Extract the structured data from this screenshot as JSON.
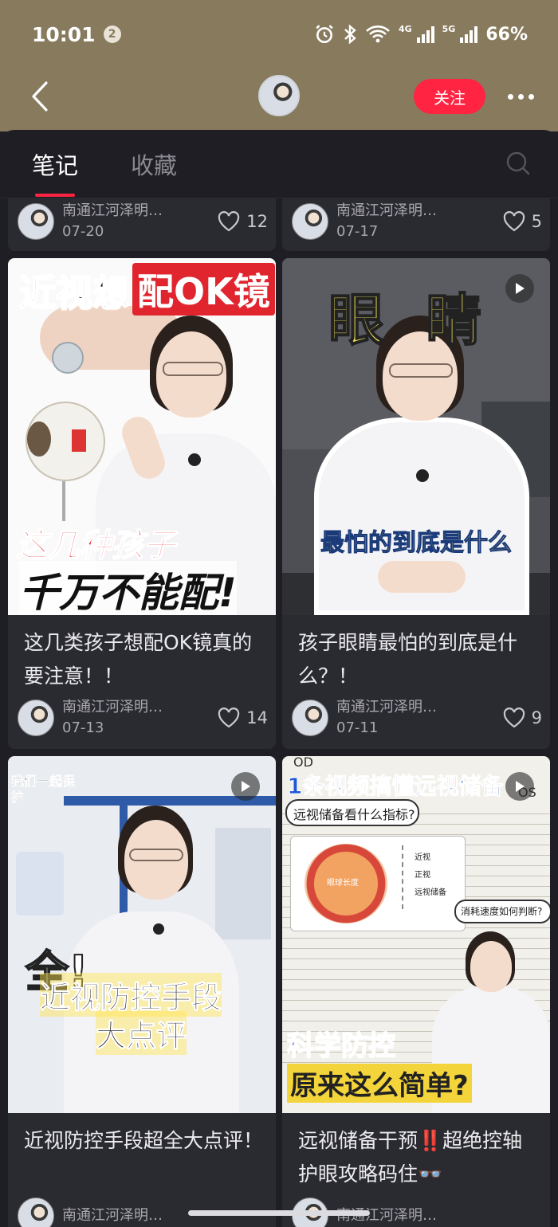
{
  "status": {
    "time": "10:01",
    "notif_count": "2",
    "battery": "66%",
    "net_4g": "4G",
    "net_5g": "5G"
  },
  "nav": {
    "follow_label": "关注"
  },
  "tabs": [
    {
      "label": "笔记",
      "active": true
    },
    {
      "label": "收藏",
      "active": false
    }
  ],
  "notes": [
    {
      "author": "南通江河泽明…",
      "date": "07-20",
      "likes": "12"
    },
    {
      "author": "南通江河泽明…",
      "date": "07-17",
      "likes": "5"
    },
    {
      "title": "这几类孩子想配OK镜真的要注意！！",
      "author": "南通江河泽明…",
      "date": "07-13",
      "likes": "14",
      "thumb_text_top_a": "近视想",
      "thumb_text_top_b": "配OK镜",
      "thumb_text_mid": "这几种孩子",
      "thumb_text_bottom": "千万不能配!"
    },
    {
      "title": "孩子眼睛最怕的到底是什么？！",
      "author": "南通江河泽明…",
      "date": "07-11",
      "likes": "9",
      "thumb_text_top": "眼 睛",
      "thumb_text_caption": "最怕的到底是什么"
    },
    {
      "title": "近视防控手段超全大点评！",
      "author": "南通江河泽明…",
      "thumb_text_corner": "我们一起保护",
      "thumb_text_a": "全!",
      "thumb_text_b": "近视防控手段",
      "thumb_text_c": "大点评"
    },
    {
      "title": "远视储备干预‼️超绝控轴护眼攻略码住👓",
      "author": "南通江河泽明…",
      "thumb_text_header": "1条视频搞懂远视储备",
      "thumb_text_od": "OD",
      "thumb_text_os": "OS",
      "thumb_text_q1": "远视储备看什么指标?",
      "thumb_text_q2": "消耗速度如何判断?",
      "thumb_text_lbl1": "近视",
      "thumb_text_lbl2": "正视",
      "thumb_text_lbl3": "远视储备",
      "thumb_text_eye": "眼球长度",
      "thumb_text_b1": "科学防控",
      "thumb_text_b2": "原来这么简单?"
    }
  ],
  "colors": {
    "accent": "#ff2442",
    "header_bg": "#887a5d",
    "panel_bg": "#1f1e24",
    "card_bg": "#2a2a31"
  }
}
